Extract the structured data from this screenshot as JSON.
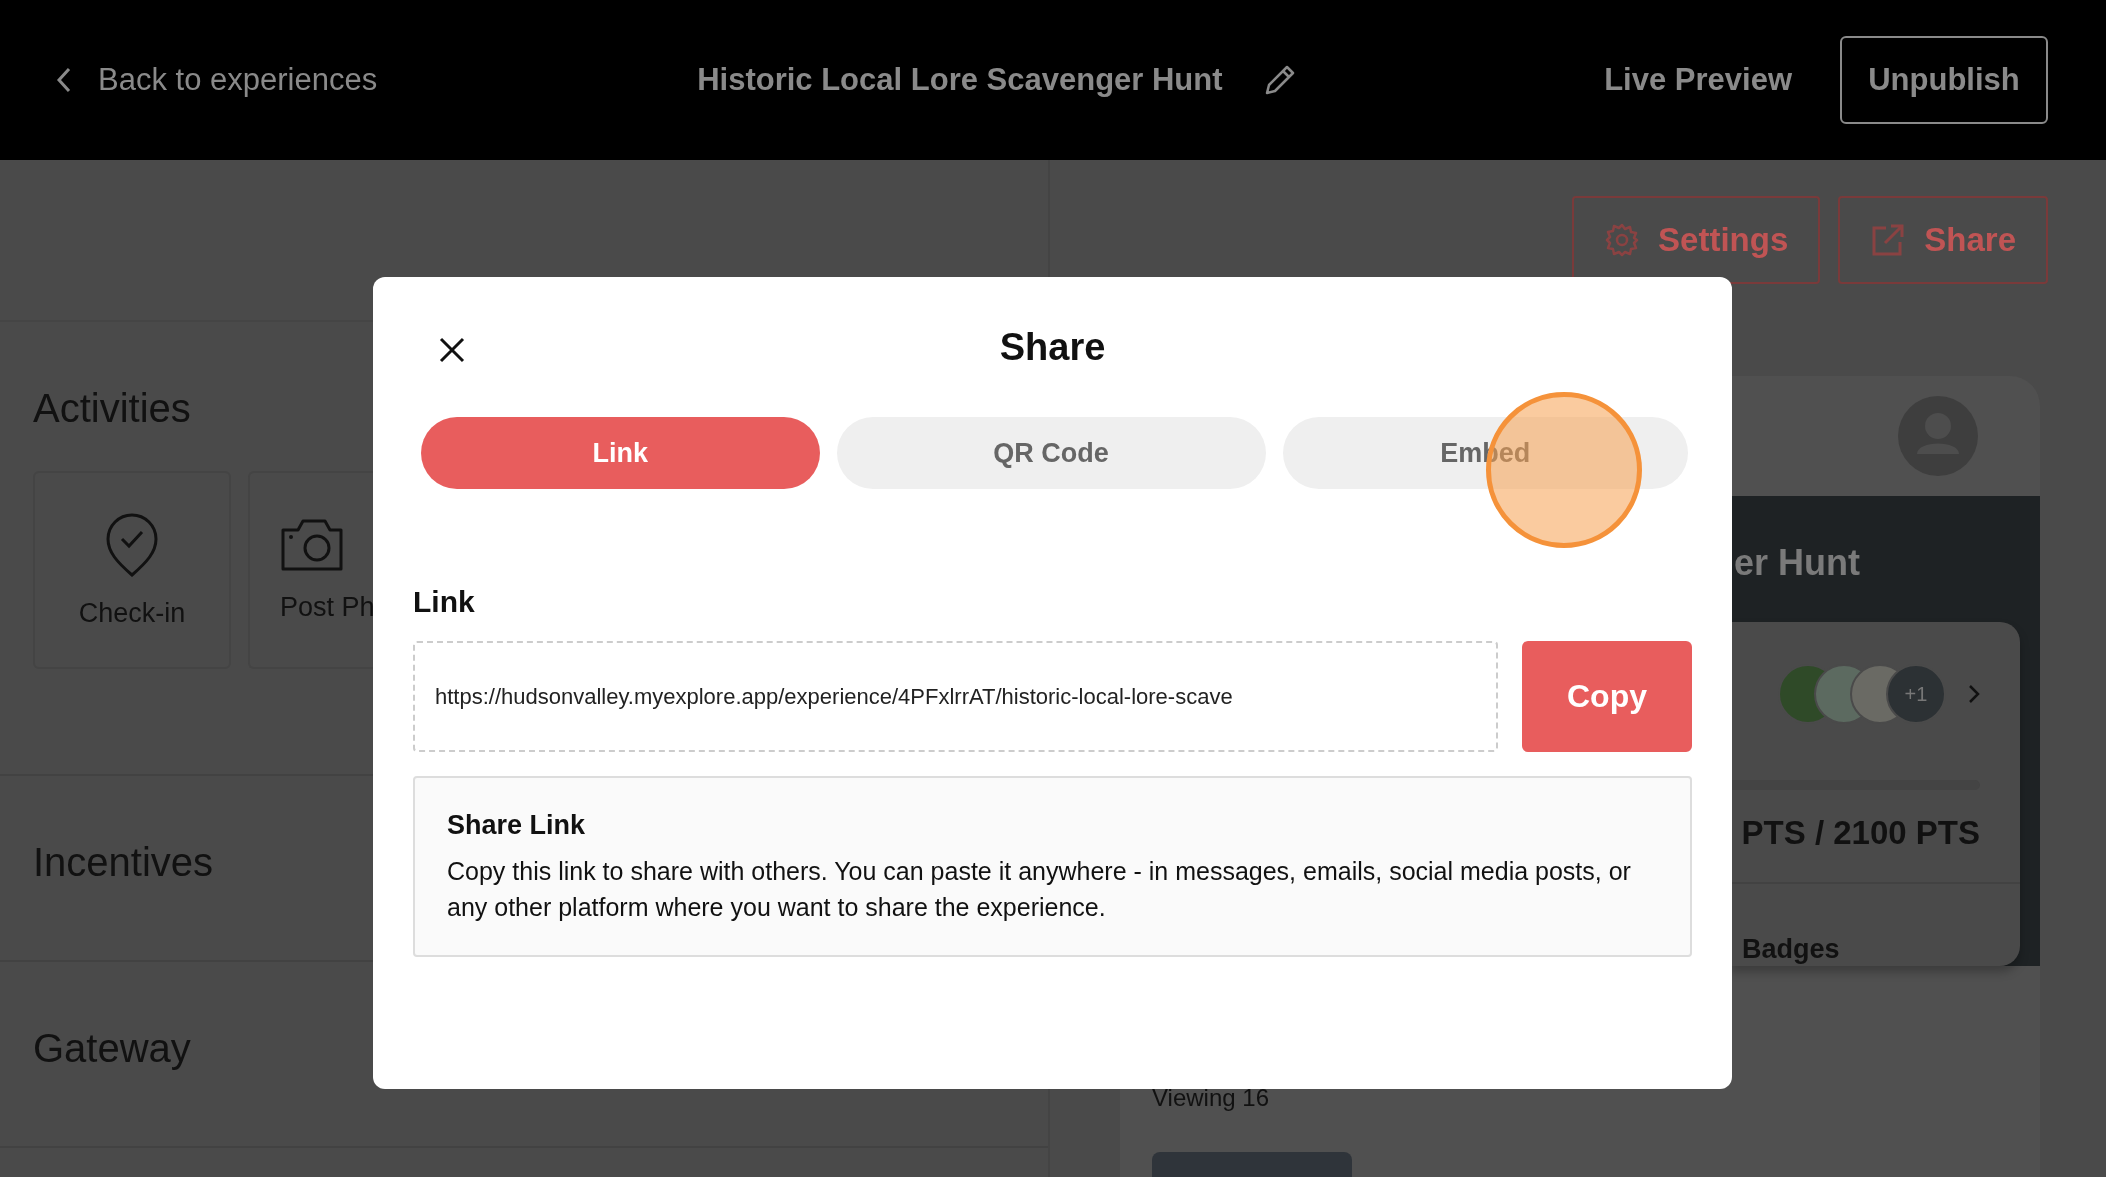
{
  "header": {
    "back_label": "Back to experiences",
    "title": "Historic Local Lore Scavenger Hunt",
    "live_preview": "Live Preview",
    "unpublish": "Unpublish"
  },
  "toolbar": {
    "settings": "Settings",
    "share": "Share"
  },
  "sections": [
    {
      "title": "Activities",
      "kind": "cards"
    },
    {
      "title": "Incentives",
      "kind": "plain"
    },
    {
      "title": "Gateway",
      "kind": "plain"
    }
  ],
  "activities": [
    {
      "label": "Check-in",
      "kind": "checkin"
    },
    {
      "label": "Post Ph",
      "kind": "photo"
    }
  ],
  "preview": {
    "title_fragment": "er Hunt",
    "more_count": "+1",
    "points": "PTS / 2100 PTS",
    "badges": "Badges",
    "viewing": "Viewing 16"
  },
  "modal": {
    "title": "Share",
    "tabs": [
      {
        "label": "Link",
        "selected": true
      },
      {
        "label": "QR Code",
        "selected": false
      },
      {
        "label": "Embed",
        "selected": false
      }
    ],
    "field_label": "Link",
    "url": "https://hudsonvalley.myexplore.app/experience/4PFxlrrAT/historic-local-lore-scave",
    "copy": "Copy",
    "info": {
      "title": "Share Link",
      "text": "Copy this link to share with others. You can paste it anywhere - in messages, emails, social media posts, or any other platform where you want to share the experience."
    }
  }
}
